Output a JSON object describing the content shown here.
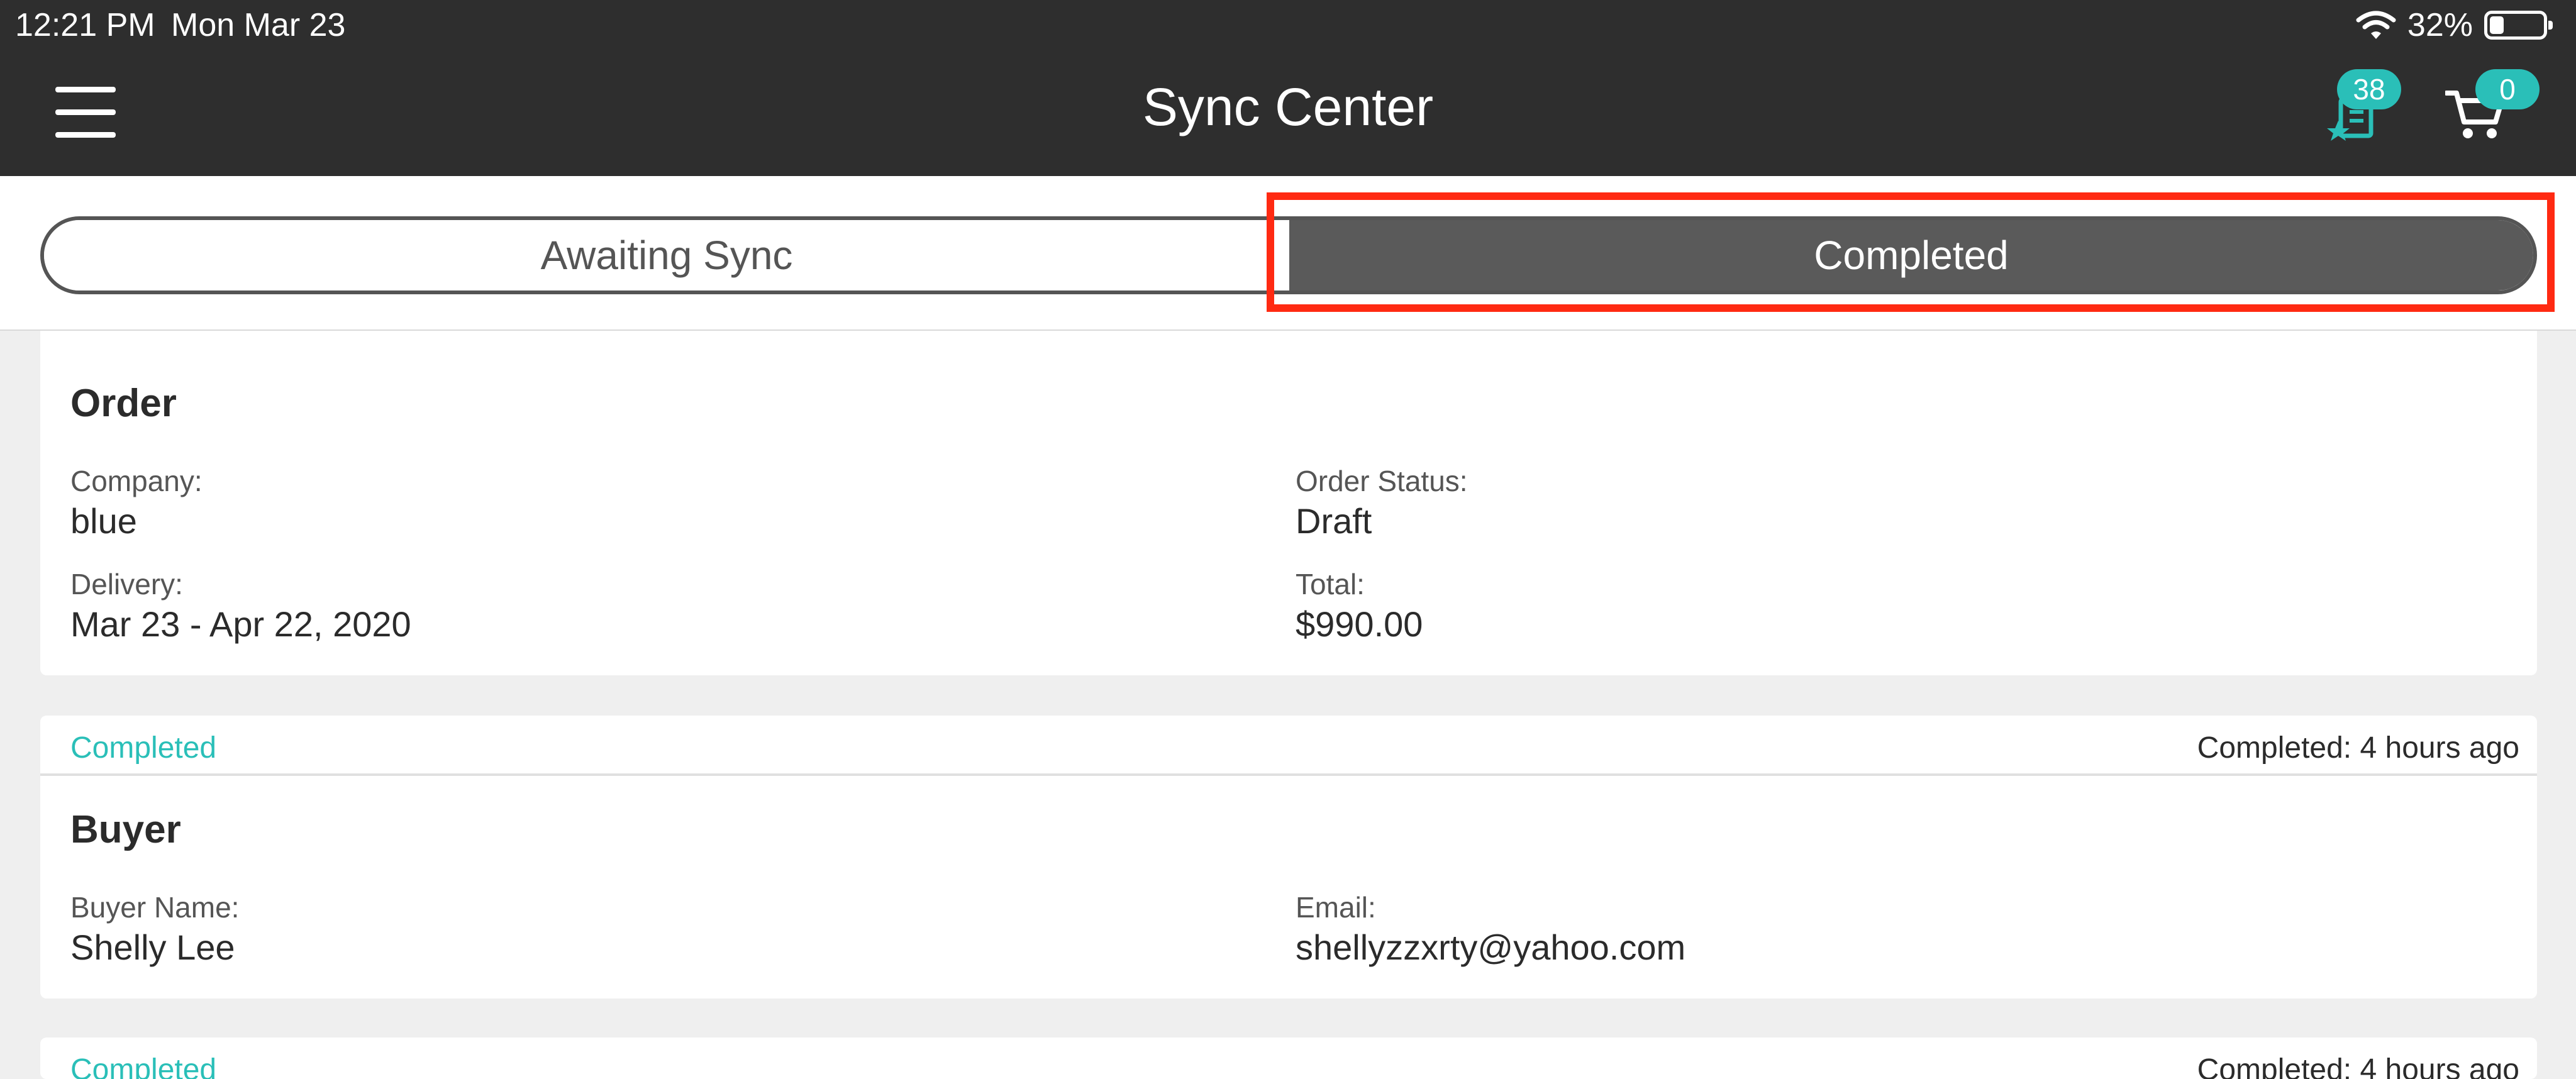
{
  "status_bar": {
    "time": "12:21 PM",
    "date": "Mon Mar 23",
    "battery": "32%"
  },
  "nav": {
    "title": "Sync Center",
    "wishlist_count": "38",
    "cart_count": "0"
  },
  "tabs": {
    "awaiting": "Awaiting Sync",
    "completed": "Completed",
    "active": "completed"
  },
  "cards": [
    {
      "title": "Order",
      "fields": [
        {
          "label": "Company:",
          "value": "blue"
        },
        {
          "label": "Order Status:",
          "value": "Draft"
        },
        {
          "label": "Delivery:",
          "value": "Mar 23 - Apr 22, 2020"
        },
        {
          "label": "Total:",
          "value": "$990.00"
        }
      ]
    },
    {
      "status": "Completed",
      "time": "Completed: 4 hours ago",
      "title": "Buyer",
      "fields": [
        {
          "label": "Buyer Name:",
          "value": "Shelly Lee"
        },
        {
          "label": "Email:",
          "value": "shellyzzxrty@yahoo.com"
        }
      ]
    },
    {
      "status": "Completed",
      "time": "Completed: 4 hours ago"
    }
  ],
  "colors": {
    "accent": "#2abfb8",
    "header": "#2e2e2e",
    "segment_active": "#5a5a5a",
    "highlight": "#ff2a12"
  },
  "icons": [
    "menu-icon",
    "wishlist-icon",
    "cart-icon",
    "wifi-icon",
    "battery-icon"
  ]
}
